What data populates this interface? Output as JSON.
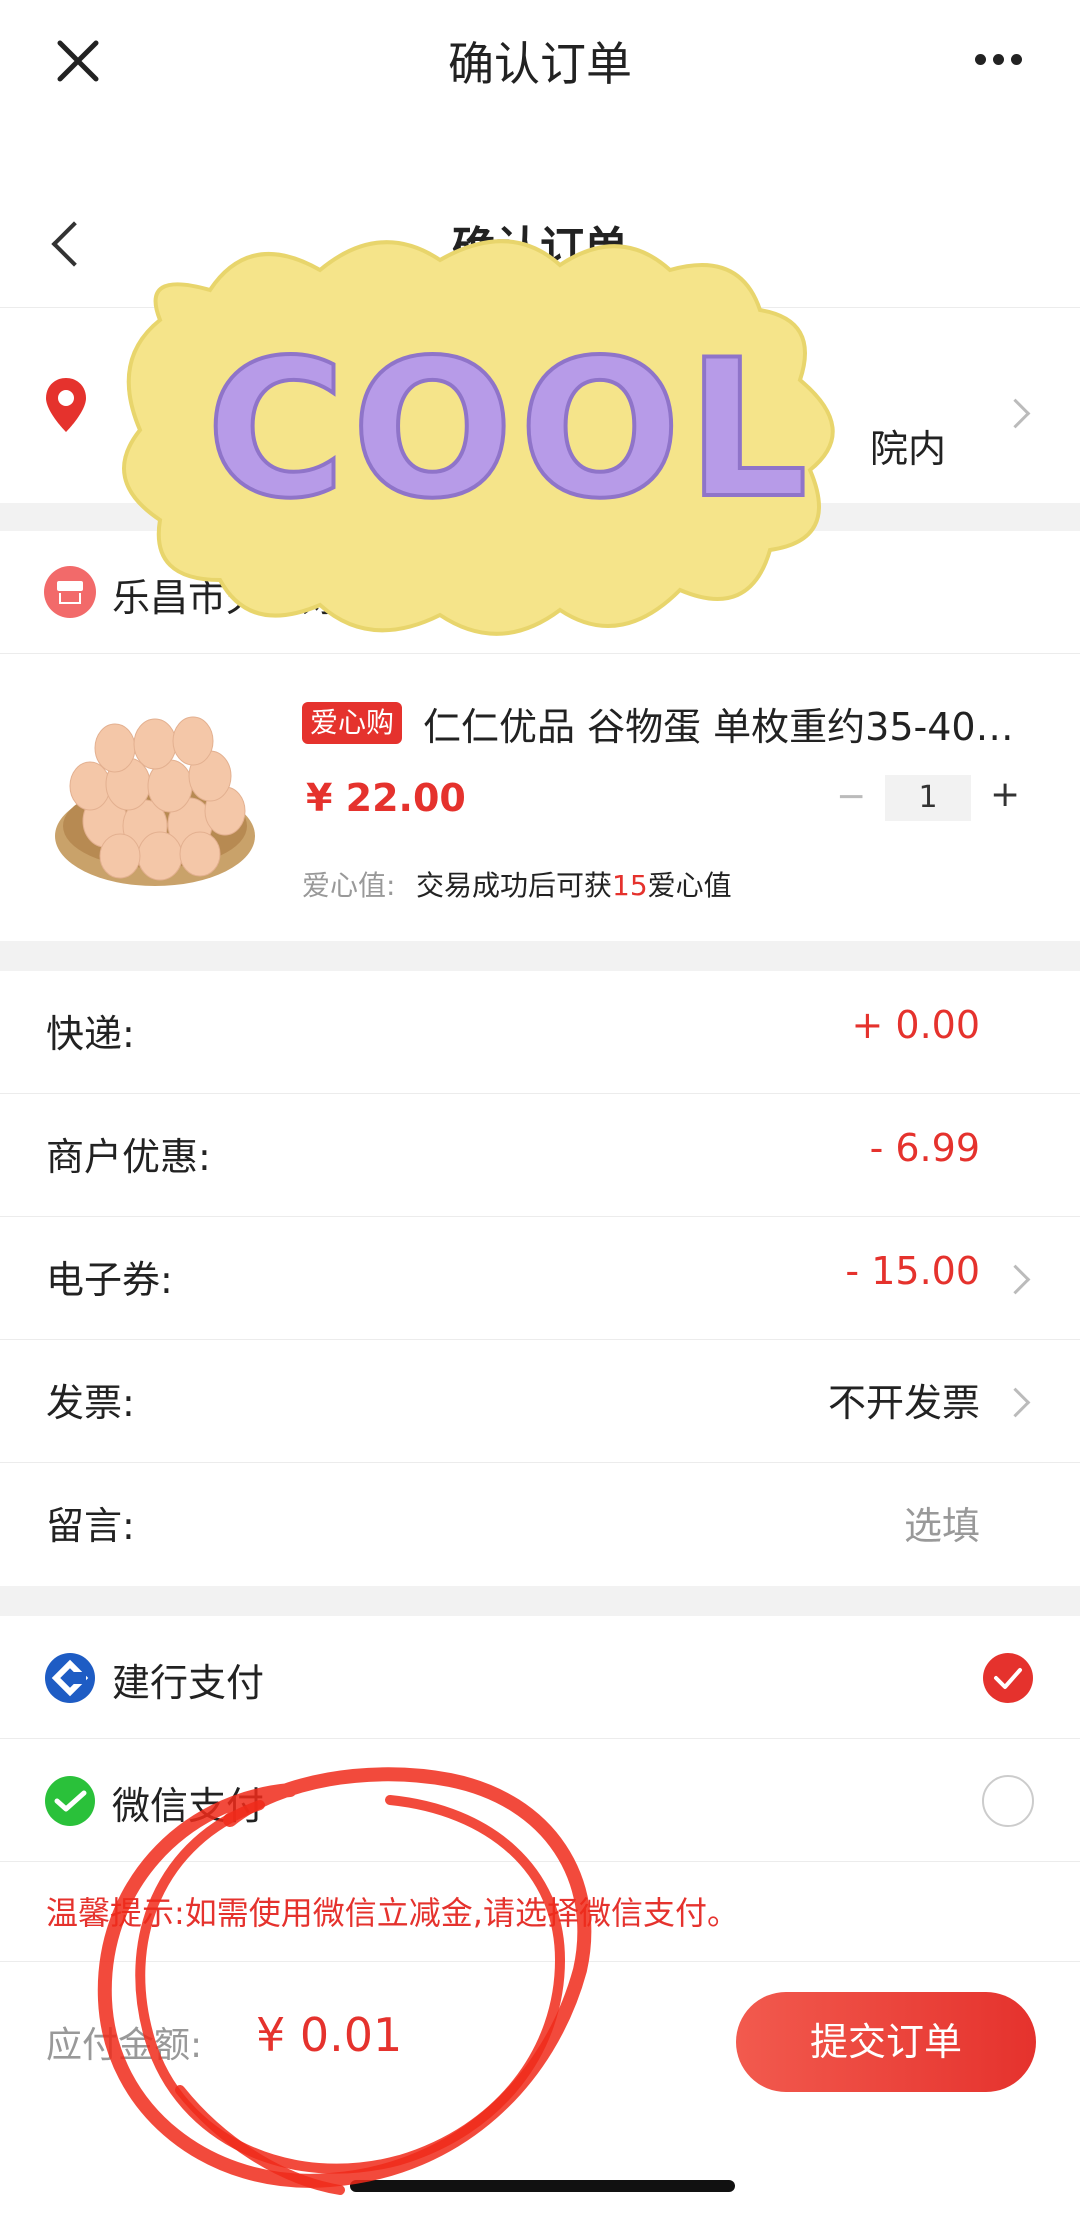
{
  "topbar": {
    "title": "确认订单"
  },
  "header": {
    "title": "确认订单"
  },
  "address": {
    "text_fragment": "院内"
  },
  "shop": {
    "name": "乐昌市天燕好"
  },
  "product": {
    "tag": "爱心购",
    "title": "仁仁优品 谷物蛋 单枚重约35-40…",
    "price": "¥ 22.00",
    "qty": "1",
    "minus": "−",
    "plus": "+",
    "love_label": "爱心值:",
    "love_pre": "交易成功后可获",
    "love_num": "15",
    "love_suf": "爱心值"
  },
  "fees": [
    {
      "label": "快递:",
      "value": "+ 0.00"
    },
    {
      "label": "商户优惠:",
      "value": "- 6.99"
    },
    {
      "label": "电子券:",
      "value": "- 15.00"
    },
    {
      "label": "发票:",
      "value": "不开发票"
    },
    {
      "label": "留言:",
      "value": "选填"
    }
  ],
  "payment": {
    "options": [
      {
        "label": "建行支付",
        "selected": true
      },
      {
        "label": "微信支付",
        "selected": false
      }
    ]
  },
  "notice": "温馨提示:如需使用微信立减金,请选择微信支付。",
  "footer": {
    "label": "应付金额:",
    "amount": "¥ 0.01",
    "submit": "提交订单"
  },
  "sticker": {
    "text": "COOL"
  },
  "colors": {
    "accent": "#e5322d",
    "ccb": "#1e5cc4",
    "wechat": "#2ac13a"
  }
}
